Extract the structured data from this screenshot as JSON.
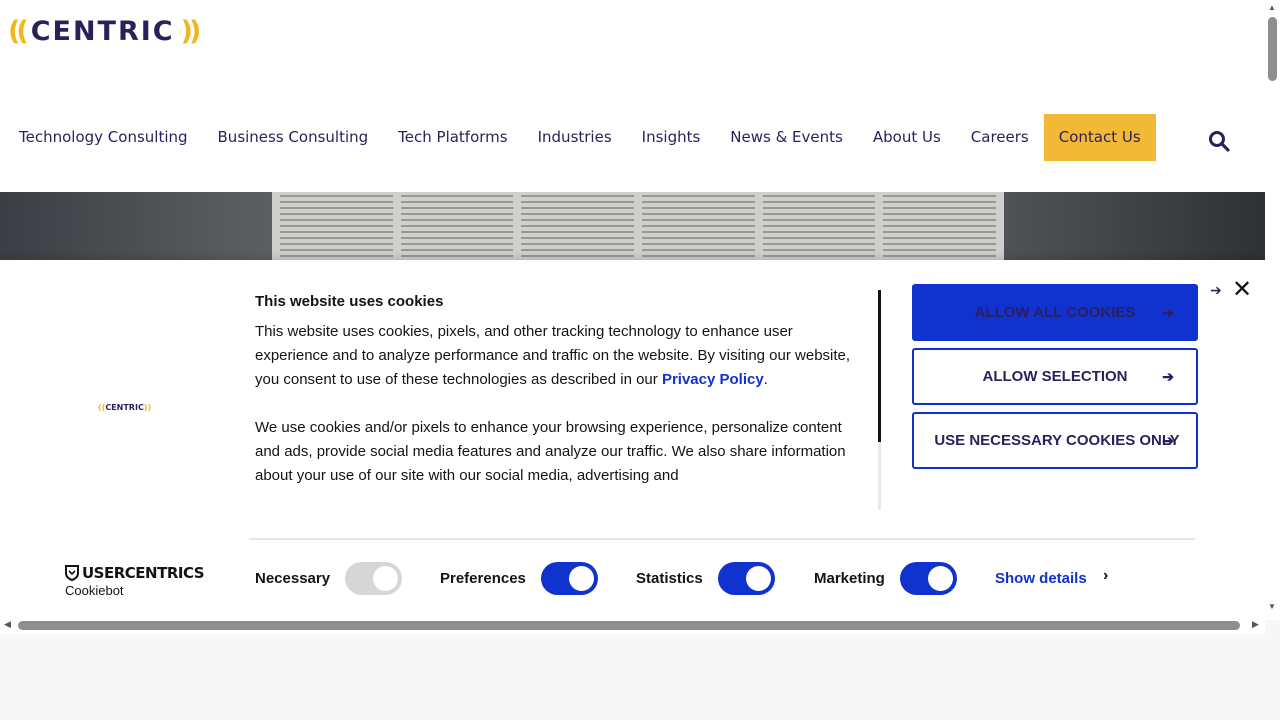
{
  "header": {
    "logo": {
      "left_paren": "((",
      "word": "CENTRIC",
      "right_paren": "))"
    },
    "nav": [
      "Technology Consulting",
      "Business Consulting",
      "Tech Platforms",
      "Industries",
      "Insights",
      "News & Events",
      "About Us",
      "Careers"
    ],
    "contact_label": "Contact Us",
    "search_icon": "search-icon"
  },
  "cookie_banner": {
    "logo": {
      "left_paren": "((",
      "word": "CENTRIC",
      "right_paren": "))"
    },
    "title": "This website uses cookies",
    "paragraph1": "This website uses cookies, pixels, and other tracking technology to enhance user experience and to analyze performance and traffic on the website. By visiting our website, you consent to use of these technologies as described in our ",
    "privacy_link": "Privacy Policy",
    "paragraph1_end": ".",
    "paragraph2": "We use cookies and/or pixels to enhance your browsing experience, personalize content and ads, provide social media features and analyze our traffic. We also share information about your use of our site with our social media, advertising and",
    "buttons": {
      "allow_all": "ALLOW ALL COOKIES",
      "allow_selection": "ALLOW SELECTION",
      "necessary_only": "USE NECESSARY COOKIES ONLY"
    },
    "branding": {
      "top": "USERCENTRICS",
      "bottom": "Cookiebot"
    },
    "toggles": {
      "necessary": {
        "label": "Necessary",
        "checked": true,
        "disabled": true
      },
      "preferences": {
        "label": "Preferences",
        "checked": true
      },
      "statistics": {
        "label": "Statistics",
        "checked": true
      },
      "marketing": {
        "label": "Marketing",
        "checked": true
      }
    },
    "show_details": "Show details",
    "colors": {
      "accent": "#1032cf",
      "brand_navy": "#2c1f5c",
      "brand_gold": "#f2b936"
    }
  }
}
